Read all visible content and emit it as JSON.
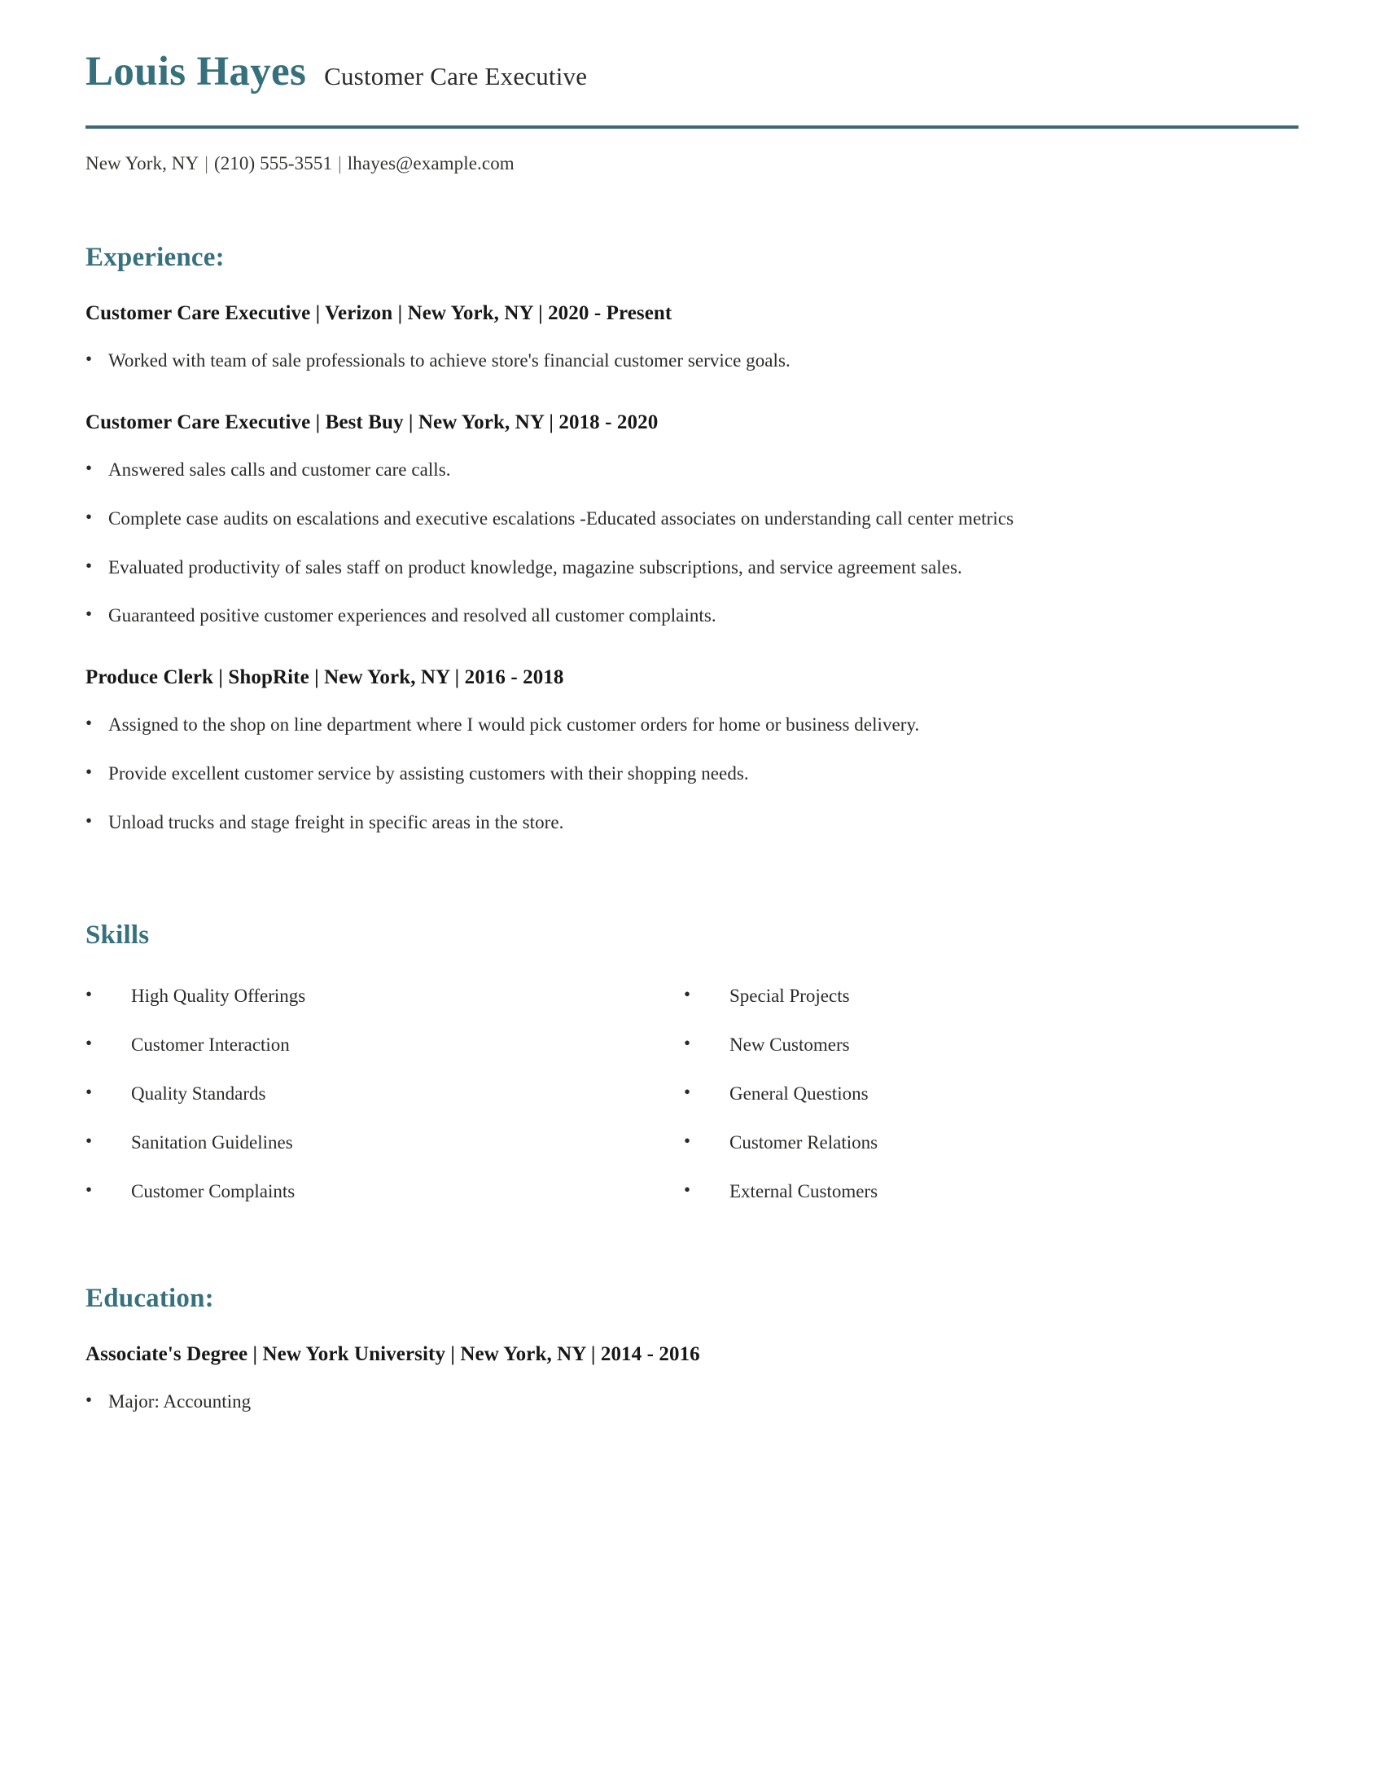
{
  "theme": {
    "accent": "#35707c",
    "rule": "#3d6a72",
    "heading": "#37717d",
    "body_text": "#2a2a28",
    "background": "#ffffff"
  },
  "header": {
    "name": "Louis Hayes",
    "job_title": "Customer Care Executive",
    "contact": {
      "location": "New York, NY",
      "separator": "|",
      "phone": "(210) 555-3551",
      "email": "lhayes@example.com"
    }
  },
  "sections": {
    "experience": {
      "title": "Experience:",
      "entries": [
        {
          "heading": "Customer Care Executive | Verizon | New York, NY | 2020 - Present",
          "role": "Customer Care Executive",
          "company": "Verizon",
          "location": "New York, NY",
          "dates": "2020 - Present",
          "bullets": [
            "Worked with team of sale professionals to achieve store's financial customer service goals."
          ]
        },
        {
          "heading": "Customer Care Executive | Best Buy | New York, NY | 2018 - 2020",
          "role": "Customer Care Executive",
          "company": "Best Buy",
          "location": "New York, NY",
          "dates": "2018 - 2020",
          "bullets": [
            "Answered sales calls and customer care calls.",
            "Complete case audits on escalations and executive escalations -Educated associates on understanding call center metrics",
            "Evaluated productivity of sales staff on product knowledge, magazine subscriptions, and service agreement sales.",
            "Guaranteed positive customer experiences and resolved all customer complaints."
          ]
        },
        {
          "heading": "Produce Clerk | ShopRite | New York, NY | 2016 - 2018",
          "role": "Produce Clerk",
          "company": "ShopRite",
          "location": "New York, NY",
          "dates": "2016 - 2018",
          "bullets": [
            "Assigned to the shop on line department where I would pick customer orders for home or business delivery.",
            "Provide excellent customer service by assisting customers with their shopping needs.",
            "Unload trucks and stage freight in specific areas in the store."
          ]
        }
      ]
    },
    "skills": {
      "title": "Skills",
      "left_column": [
        "High Quality Offerings",
        "Customer Interaction",
        "Quality Standards",
        "Sanitation Guidelines",
        "Customer Complaints"
      ],
      "right_column": [
        "Special Projects",
        "New Customers",
        "General Questions",
        "Customer Relations",
        "External Customers"
      ]
    },
    "education": {
      "title": "Education:",
      "entries": [
        {
          "heading": "Associate's Degree | New York University | New York, NY | 2014 - 2016",
          "degree": "Associate's Degree",
          "school": "New York University",
          "location": "New York, NY",
          "dates": "2014 - 2016",
          "bullets": [
            "Major: Accounting"
          ]
        }
      ]
    }
  }
}
